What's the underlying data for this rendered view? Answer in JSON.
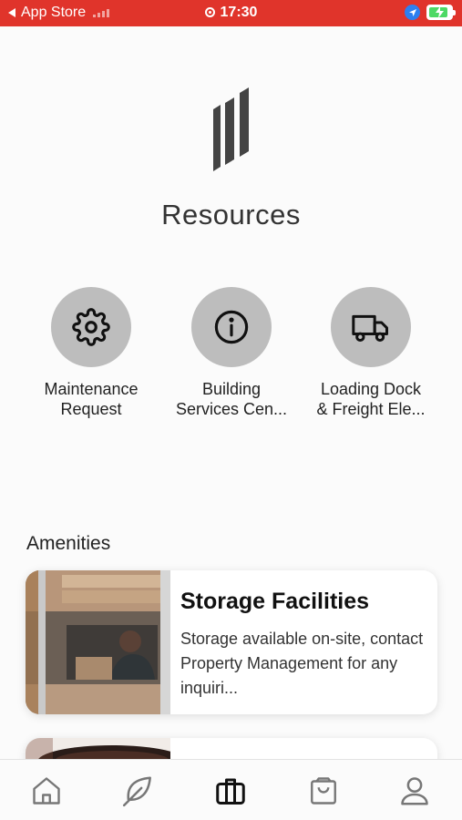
{
  "status_bar": {
    "back_app": "App Store",
    "time": "17:30"
  },
  "page": {
    "title": "Resources"
  },
  "resources": [
    {
      "label_line1": "Maintenance",
      "label_line2": "Request",
      "icon": "gear-icon"
    },
    {
      "label_line1": "Building",
      "label_line2": "Services Cen...",
      "icon": "info-icon"
    },
    {
      "label_line1": "Loading Dock",
      "label_line2": "& Freight Ele...",
      "icon": "truck-icon"
    }
  ],
  "amenities": {
    "section_title": "Amenities",
    "cards": [
      {
        "title": "Storage Facilities",
        "description": "Storage available on-site, contact Property Management for any inquiri..."
      }
    ]
  },
  "bottom_nav": [
    {
      "icon": "home-icon",
      "active": false
    },
    {
      "icon": "leaf-icon",
      "active": false
    },
    {
      "icon": "briefcase-icon",
      "active": true
    },
    {
      "icon": "shopping-bag-icon",
      "active": false
    },
    {
      "icon": "profile-icon",
      "active": false
    }
  ],
  "colors": {
    "status_bar": "#e0342b",
    "icon_circle": "#bdbdbd",
    "nav_inactive": "#777777",
    "nav_active": "#111111"
  }
}
